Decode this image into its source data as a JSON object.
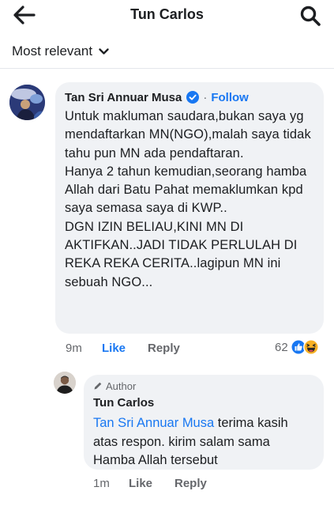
{
  "header": {
    "title": "Tun Carlos",
    "back_icon": "arrow-left-icon",
    "search_icon": "search-icon"
  },
  "sort": {
    "label": "Most relevant",
    "icon": "chevron-down-icon"
  },
  "comment": {
    "author": "Tan Sri Annuar Musa",
    "verified_icon": "verified-badge-icon",
    "separator": "·",
    "follow_label": "Follow",
    "text": "Untuk makluman saudara,bukan saya yg mendaftarkan MN(NGO),malah saya tidak tahu pun MN ada pendaftaran.\nHanya 2 tahun kemudian,seorang hamba Allah dari Batu Pahat memaklumkan kpd saya semasa saya di KWP..\nDGN IZIN BELIAU,KINI MN DI AKTIFKAN..JADI TIDAK PERLULAH DI REKA REKA CERITA..lagipun MN ini sebuah NGO...",
    "time": "9m",
    "like_label": "Like",
    "reply_label": "Reply",
    "reaction_count": "62",
    "reaction_icons": [
      "like-reaction-icon",
      "haha-reaction-icon"
    ]
  },
  "reply": {
    "badge": "Author",
    "badge_icon": "pencil-icon",
    "author": "Tun Carlos",
    "mention": "Tan Sri Annuar Musa",
    "text": " terima kasih atas respon. kirim salam sama Hamba Allah tersebut",
    "time": "1m",
    "like_label": "Like",
    "reply_label": "Reply"
  },
  "colors": {
    "link_blue": "#1877f2",
    "bubble_bg": "#f0f2f5",
    "secondary_text": "#65676b",
    "primary_text": "#1c1e21",
    "haha_yellow": "#f7b125"
  }
}
